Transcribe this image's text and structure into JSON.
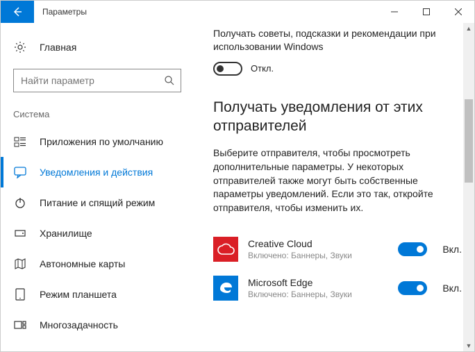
{
  "window": {
    "title": "Параметры"
  },
  "sidebar": {
    "home": "Главная",
    "search_placeholder": "Найти параметр",
    "group": "Система",
    "items": [
      {
        "label": "Приложения по умолчанию"
      },
      {
        "label": "Уведомления и действия"
      },
      {
        "label": "Питание и спящий режим"
      },
      {
        "label": "Хранилище"
      },
      {
        "label": "Автономные карты"
      },
      {
        "label": "Режим планшета"
      },
      {
        "label": "Многозадачность"
      }
    ]
  },
  "content": {
    "tips_desc": "Получать советы, подсказки и рекомендации при использовании Windows",
    "off_label": "Откл.",
    "section_header": "Получать уведомления от этих отправителей",
    "section_body": "Выберите отправителя, чтобы просмотреть дополнительные параметры. У некоторых отправителей также могут быть собственные параметры уведомлений. Если это так, откройте отправителя, чтобы изменить их.",
    "on_label": "Вкл.",
    "apps": [
      {
        "name": "Creative Cloud",
        "sub": "Включено: Баннеры, Звуки"
      },
      {
        "name": "Microsoft Edge",
        "sub": "Включено: Баннеры, Звуки"
      }
    ]
  }
}
